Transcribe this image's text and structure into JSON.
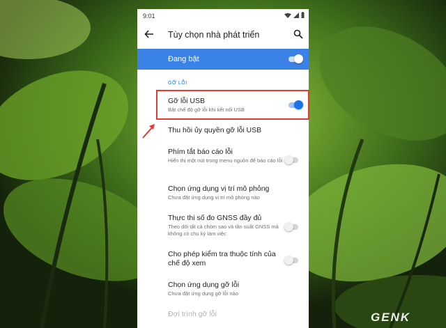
{
  "status_bar": {
    "time": "9:01"
  },
  "app_bar": {
    "title": "Tùy chọn nhà phát triển"
  },
  "master_switch": {
    "label": "Đang bật",
    "checked": true
  },
  "section": {
    "label": "GỠ LỖI"
  },
  "items": [
    {
      "title": "Gỡ lỗi USB",
      "subtitle": "Bật chế độ gỡ lỗi khi kết nối USB",
      "toggle": "on"
    },
    {
      "title": "Thu hồi ủy quyền gỡ lỗi USB",
      "subtitle": "",
      "toggle": "none"
    },
    {
      "title": "Phím tắt báo cáo lỗi",
      "subtitle": "Hiển thị một nút trong menu nguồn để báo cáo lỗi",
      "toggle": "off"
    },
    {
      "title": "Chọn ứng dụng vị trí mô phỏng",
      "subtitle": "Chưa đặt ứng dụng vị trí mô phỏng nào",
      "toggle": "none"
    },
    {
      "title": "Thực thi số đo GNSS đầy đủ",
      "subtitle": "Theo dõi tất cả chòm sao và tần suất GNSS mà không có chu kỳ làm việc",
      "toggle": "off"
    },
    {
      "title": "Cho phép kiểm tra thuộc tính của chế độ xem",
      "subtitle": "",
      "toggle": "off"
    },
    {
      "title": "Chọn ứng dụng gỡ lỗi",
      "subtitle": "Chưa đặt ứng dụng gỡ lỗi nào",
      "toggle": "none"
    },
    {
      "title": "Đợi trình gỡ lỗi",
      "subtitle": "",
      "toggle": "none"
    }
  ],
  "watermark": {
    "text": "GENK"
  },
  "colors": {
    "accent": "#1a73e8",
    "master_bar": "#3b82e6",
    "highlight": "#e53935"
  },
  "icons": [
    "back-arrow-icon",
    "search-icon",
    "wifi-icon",
    "signal-icon",
    "battery-icon"
  ]
}
